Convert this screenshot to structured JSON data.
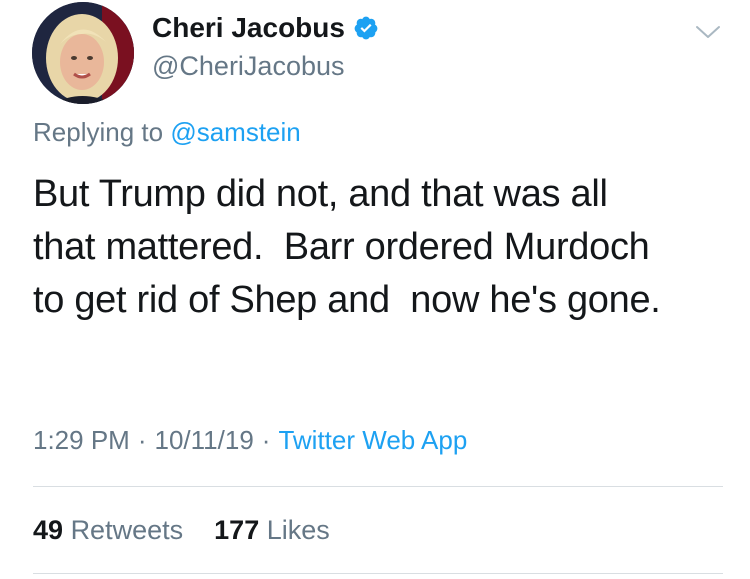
{
  "user": {
    "display_name": "Cheri Jacobus",
    "handle": "@CheriJacobus",
    "verified": true
  },
  "reply": {
    "prefix": "Replying to",
    "mention": "@samstein"
  },
  "tweet": {
    "lines": [
      "But Trump did not, and that was all",
      "that mattered.  Barr ordered Murdoch",
      "to get rid of Shep and  now he's gone."
    ]
  },
  "meta": {
    "time": "1:29 PM",
    "date": "10/11/19",
    "separator": "·",
    "source": "Twitter Web App"
  },
  "stats": {
    "retweets_count": "49",
    "retweets_label": "Retweets",
    "likes_count": "177",
    "likes_label": "Likes"
  },
  "icons": {
    "verified": "verified-badge-icon",
    "menu": "chevron-down-icon"
  },
  "colors": {
    "link": "#1da1f2",
    "secondary_text": "#657786",
    "primary_text": "#14171a"
  }
}
